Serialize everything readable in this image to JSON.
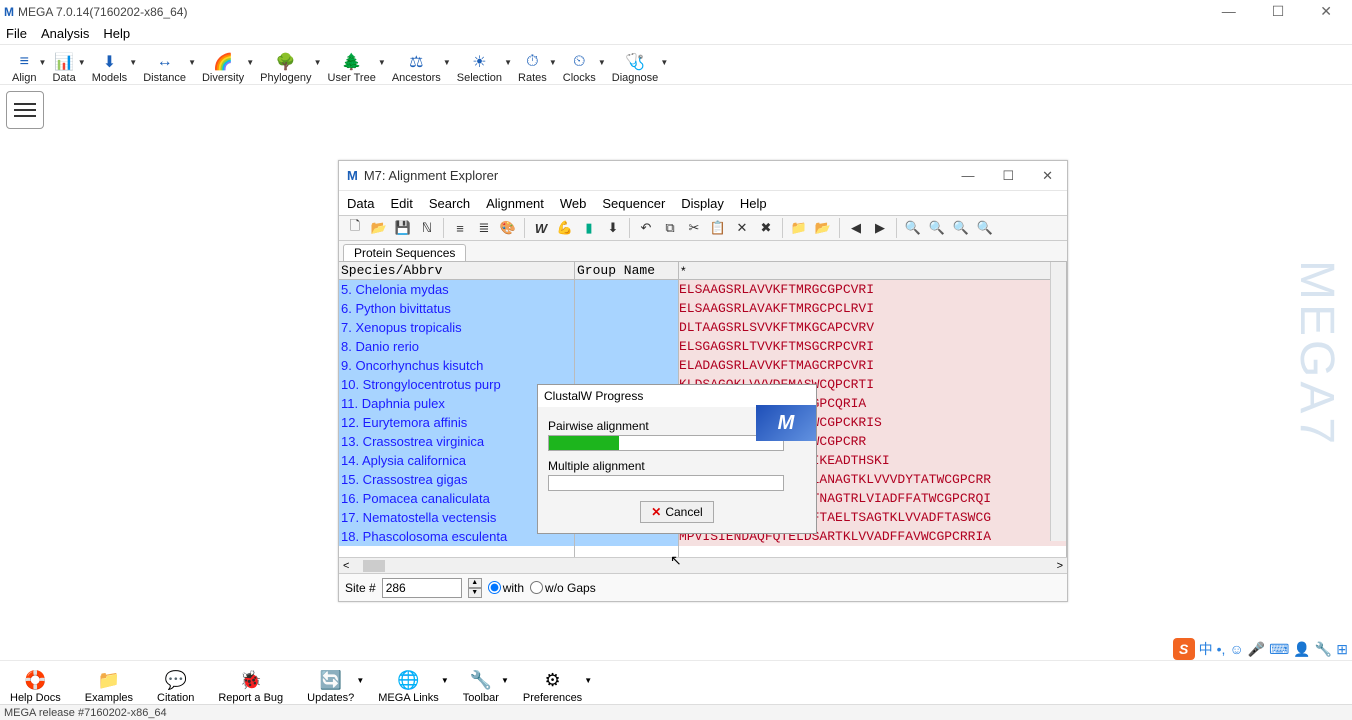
{
  "app": {
    "title": "MEGA 7.0.14(7160202-x86_64)",
    "watermark": "MEGA7"
  },
  "menubar": [
    "File",
    "Analysis",
    "Help"
  ],
  "toolbar": [
    {
      "id": "align",
      "label": "Align",
      "dd": true
    },
    {
      "id": "data",
      "label": "Data",
      "dd": true
    },
    {
      "id": "models",
      "label": "Models",
      "dd": true
    },
    {
      "id": "distance",
      "label": "Distance",
      "dd": true
    },
    {
      "id": "diversity",
      "label": "Diversity",
      "dd": true
    },
    {
      "id": "phylogeny",
      "label": "Phylogeny",
      "dd": true
    },
    {
      "id": "usertree",
      "label": "User Tree",
      "dd": true
    },
    {
      "id": "ancestors",
      "label": "Ancestors",
      "dd": true
    },
    {
      "id": "selection",
      "label": "Selection",
      "dd": true
    },
    {
      "id": "rates",
      "label": "Rates",
      "dd": true
    },
    {
      "id": "clocks",
      "label": "Clocks",
      "dd": true
    },
    {
      "id": "diagnose",
      "label": "Diagnose",
      "dd": true
    }
  ],
  "toolbar_icons": [
    "≡",
    "📊",
    "⬇",
    "↔",
    "🌈",
    "🌳",
    "🌲",
    "⚖",
    "☀",
    "⏱",
    "⏲",
    "🩺"
  ],
  "ae": {
    "title": "M7: Alignment Explorer",
    "menubar": [
      "Data",
      "Edit",
      "Search",
      "Alignment",
      "Web",
      "Sequencer",
      "Display",
      "Help"
    ],
    "tab": "Protein Sequences",
    "hdr_species": "Species/Abbrv",
    "hdr_group": "Group Name",
    "hdr_star": "*",
    "species": [
      "5. Chelonia mydas",
      "6. Python bivittatus",
      "7. Xenopus tropicalis",
      "8. Danio rerio",
      "9. Oncorhynchus kisutch",
      "10. Strongylocentrotus purp",
      "11. Daphnia pulex",
      "12. Eurytemora affinis",
      "13. Crassostrea virginica",
      "14. Aplysia californica",
      "15. Crassostrea gigas",
      "16. Pomacea canaliculata",
      "17. Nematostella vectensis",
      "18. Phascolosoma esculenta"
    ],
    "sequences": [
      "ELSAAGSRLAVVKFTMRGCGPCVRI",
      "ELSAAGSRLAVAKFTMRGCPCLRVI",
      "DLTAAGSRLSVVKFTMKGCAPCVRV",
      "ELSGAGSRLTVVKFTMSGCRPCVRI",
      "ELADAGSRLAVVKFTMAGCRPCVRI",
      "KLDSAGQKLVVVDFMASWCQPCRTI",
      "NAAGTKLVVVDFTATWCGPCQRIA",
      "ELANAGTKLVVVDFTASWCGPCKRIS",
      "ELANAGTKLVVVDYTATWCGPCRR",
      "MANVHHVSSNDAQFDVDIKEADTHSKI",
      "MTGTVRMVTEDSQFQPELANAGTKLVVVDYTATWCGPCRR",
      "MSNVRIITDDTQFSSELTNAGTRLVIADFFATWCGPCRQI",
      "MAAAPRGNVKVLELDSQFTAELTSAGTKLVVADFTASWCG",
      "MPVISIENDAQFQTELDSARTKLVVADFFAVWCGPCRRIA"
    ],
    "site_label": "Site #",
    "site_value": "286",
    "with": "with",
    "without": "w/o Gaps"
  },
  "clustal": {
    "title": "ClustalW Progress",
    "pairwise": "Pairwise alignment",
    "multiple": "Multiple alignment",
    "cancel": "Cancel",
    "pairwise_pct": 30,
    "logo": "M"
  },
  "bottom": [
    {
      "id": "helpdocs",
      "label": "Help Docs"
    },
    {
      "id": "examples",
      "label": "Examples"
    },
    {
      "id": "citation",
      "label": "Citation"
    },
    {
      "id": "reportbug",
      "label": "Report a Bug"
    },
    {
      "id": "updates",
      "label": "Updates?",
      "dd": true
    },
    {
      "id": "megalinks",
      "label": "MEGA Links",
      "dd": true
    },
    {
      "id": "toolbar",
      "label": "Toolbar",
      "dd": true
    },
    {
      "id": "preferences",
      "label": "Preferences",
      "dd": true
    }
  ],
  "bottom_icons": [
    "🛟",
    "📁",
    "💬",
    "🐞",
    "🔄",
    "🌐",
    "🔧",
    "⚙"
  ],
  "status": "MEGA release #7160202-x86_64"
}
